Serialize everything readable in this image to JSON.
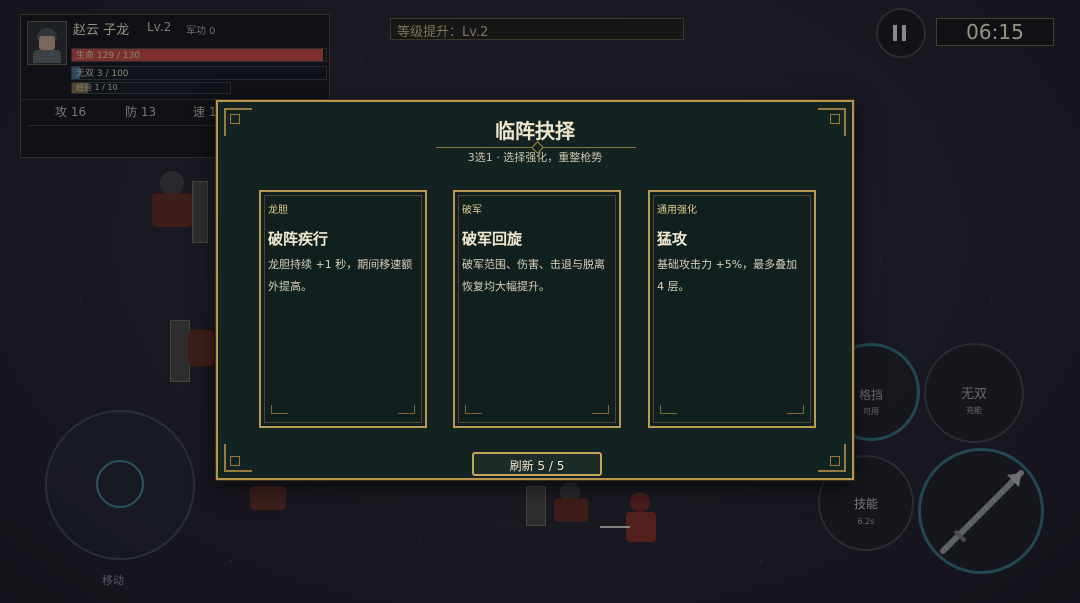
{
  "hud": {
    "name": "赵云 子龙",
    "level": "Lv.2",
    "merit": "军功 0",
    "hp_text": "生命 129 / 130",
    "hp_fraction": 0.99,
    "musou_text": "无双 3 / 100",
    "musou_fraction": 0.03,
    "exp_text": "经验 1 / 10",
    "exp_fraction": 0.1,
    "attack": "攻 16",
    "defense": "防 13",
    "speed": "速 1"
  },
  "level_banner": "等级提升：Lv.2",
  "timer": "06:15",
  "modal": {
    "title": "临阵抉择",
    "subtitle": "3选1 · 选择强化，重整枪势",
    "cards": [
      {
        "tag": "龙胆",
        "name": "破阵疾行",
        "desc": "龙胆持续 +1 秒，期间移速额外提高。"
      },
      {
        "tag": "破军",
        "name": "破军回旋",
        "desc": "破军范围、伤害、击退与脱离恢复均大幅提升。"
      },
      {
        "tag": "通用强化",
        "name": "猛攻",
        "desc": "基础攻击力 +5%，最多叠加 4 层。"
      }
    ],
    "refresh": "刷新 5 / 5"
  },
  "controls": {
    "joystick_label": "移动",
    "block": {
      "label": "格挡",
      "status": "可用"
    },
    "musou": {
      "label": "无双",
      "status": "充能"
    },
    "skill": {
      "label": "技能",
      "status": "6.2s"
    }
  },
  "colors": {
    "accent_gold": "#b9944e",
    "hp": "#b8463c",
    "musou": "#3f6b8a",
    "exp": "#7a6a3a",
    "ring": "#2e6a76"
  }
}
